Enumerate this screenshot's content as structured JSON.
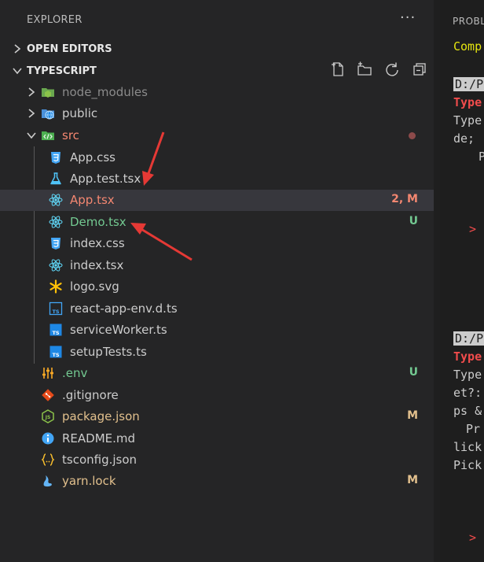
{
  "explorer": {
    "title": "EXPLORER",
    "more": "···",
    "sections": {
      "open_editors": "OPEN EDITORS",
      "typescript": "TYPESCRIPT"
    },
    "items": [
      {
        "name": "node_modules",
        "icon": "node-folder-icon",
        "color": "#8b8b8b",
        "badge": ""
      },
      {
        "name": "public",
        "icon": "globe-folder-icon",
        "color": "#cccccc",
        "badge": ""
      },
      {
        "name": "src",
        "icon": "src-folder-icon",
        "color": "#f48771",
        "badge": ""
      },
      {
        "name": "App.css",
        "icon": "css-icon",
        "color": "#cccccc",
        "badge": ""
      },
      {
        "name": "App.test.tsx",
        "icon": "flask-icon",
        "color": "#cccccc",
        "badge": ""
      },
      {
        "name": "App.tsx",
        "icon": "react-icon",
        "color": "#f48771",
        "badge": "2, M"
      },
      {
        "name": "Demo.tsx",
        "icon": "react-icon",
        "color": "#73c991",
        "badge": "U"
      },
      {
        "name": "index.css",
        "icon": "css-icon",
        "color": "#cccccc",
        "badge": ""
      },
      {
        "name": "index.tsx",
        "icon": "react-icon",
        "color": "#cccccc",
        "badge": ""
      },
      {
        "name": "logo.svg",
        "icon": "asterisk-icon",
        "color": "#cccccc",
        "badge": ""
      },
      {
        "name": "react-app-env.d.ts",
        "icon": "ts-outline-icon",
        "color": "#cccccc",
        "badge": ""
      },
      {
        "name": "serviceWorker.ts",
        "icon": "ts-icon",
        "color": "#cccccc",
        "badge": ""
      },
      {
        "name": "setupTests.ts",
        "icon": "ts-icon",
        "color": "#cccccc",
        "badge": ""
      },
      {
        "name": ".env",
        "icon": "sliders-icon",
        "color": "#73c991",
        "badge": "U"
      },
      {
        "name": ".gitignore",
        "icon": "git-icon",
        "color": "#cccccc",
        "badge": ""
      },
      {
        "name": "package.json",
        "icon": "nodejs-icon",
        "color": "#e2c08d",
        "badge": "M"
      },
      {
        "name": "README.md",
        "icon": "info-icon",
        "color": "#cccccc",
        "badge": ""
      },
      {
        "name": "tsconfig.json",
        "icon": "json-braces-icon",
        "color": "#cccccc",
        "badge": ""
      },
      {
        "name": "yarn.lock",
        "icon": "yarn-icon",
        "color": "#e2c08d",
        "badge": "M"
      }
    ]
  },
  "right_panel": {
    "tab": "PROBL",
    "lines": [
      "Comp",
      "D:/P",
      "Type",
      "Type",
      "de;",
      "Pr",
      ">",
      "D:/P",
      "Type",
      "Type",
      "et?:",
      "ps &",
      "Pr",
      "lick",
      "Pick",
      ">"
    ]
  },
  "colors": {
    "modified": "#e2c08d",
    "untracked": "#73c991",
    "error": "#f48771",
    "selected_row": "#37373d"
  }
}
